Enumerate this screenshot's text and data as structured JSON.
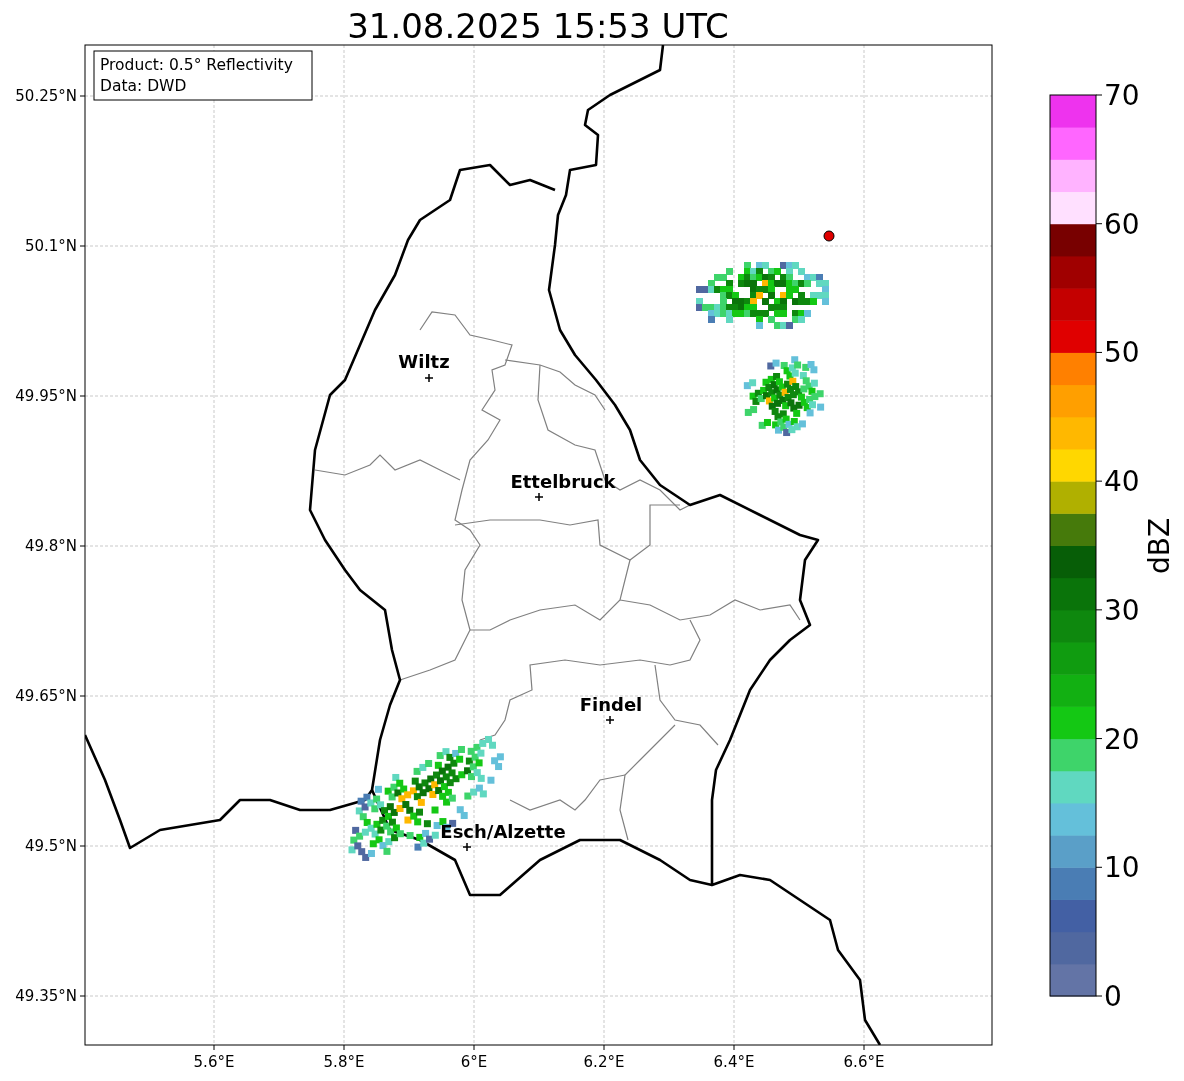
{
  "title": "31.08.2025 15:53 UTC",
  "info_box": [
    "Product: 0.5° Reflectivity",
    "Data: DWD"
  ],
  "map": {
    "y_ticks": [
      "50.25°N",
      "50.1°N",
      "49.95°N",
      "49.8°N",
      "49.65°N",
      "49.5°N",
      "49.35°N"
    ],
    "x_ticks": [
      "5.6°E",
      "5.8°E",
      "6°E",
      "6.2°E",
      "6.4°E",
      "6.6°E"
    ],
    "cities": [
      {
        "name": "Wiltz"
      },
      {
        "name": "Ettelbruck"
      },
      {
        "name": "Findel"
      },
      {
        "name": "Esch/Alzette"
      }
    ]
  },
  "colorbar": {
    "label": "dBZ",
    "ticks": [
      "70",
      "60",
      "50",
      "40",
      "30",
      "20",
      "10",
      "0"
    ],
    "bands": [
      {
        "color": "#6374a6"
      },
      {
        "color": "#5068a0"
      },
      {
        "color": "#4360a4"
      },
      {
        "color": "#4a7db4"
      },
      {
        "color": "#5a9fc8"
      },
      {
        "color": "#64c0da"
      },
      {
        "color": "#60d8c0"
      },
      {
        "color": "#3ed46a"
      },
      {
        "color": "#14c814"
      },
      {
        "color": "#12b012"
      },
      {
        "color": "#109c10"
      },
      {
        "color": "#0e880e"
      },
      {
        "color": "#0a740a"
      },
      {
        "color": "#075e07"
      },
      {
        "color": "#467a0b"
      },
      {
        "color": "#b0b000"
      },
      {
        "color": "#ffd700"
      },
      {
        "color": "#ffb800"
      },
      {
        "color": "#ff9f00"
      },
      {
        "color": "#ff8000"
      },
      {
        "color": "#e00000"
      },
      {
        "color": "#c40000"
      },
      {
        "color": "#a00000"
      },
      {
        "color": "#780000"
      },
      {
        "color": "#ffe0ff"
      },
      {
        "color": "#ffb3ff"
      },
      {
        "color": "#ff66ff"
      },
      {
        "color": "#ee33ee"
      }
    ]
  }
}
